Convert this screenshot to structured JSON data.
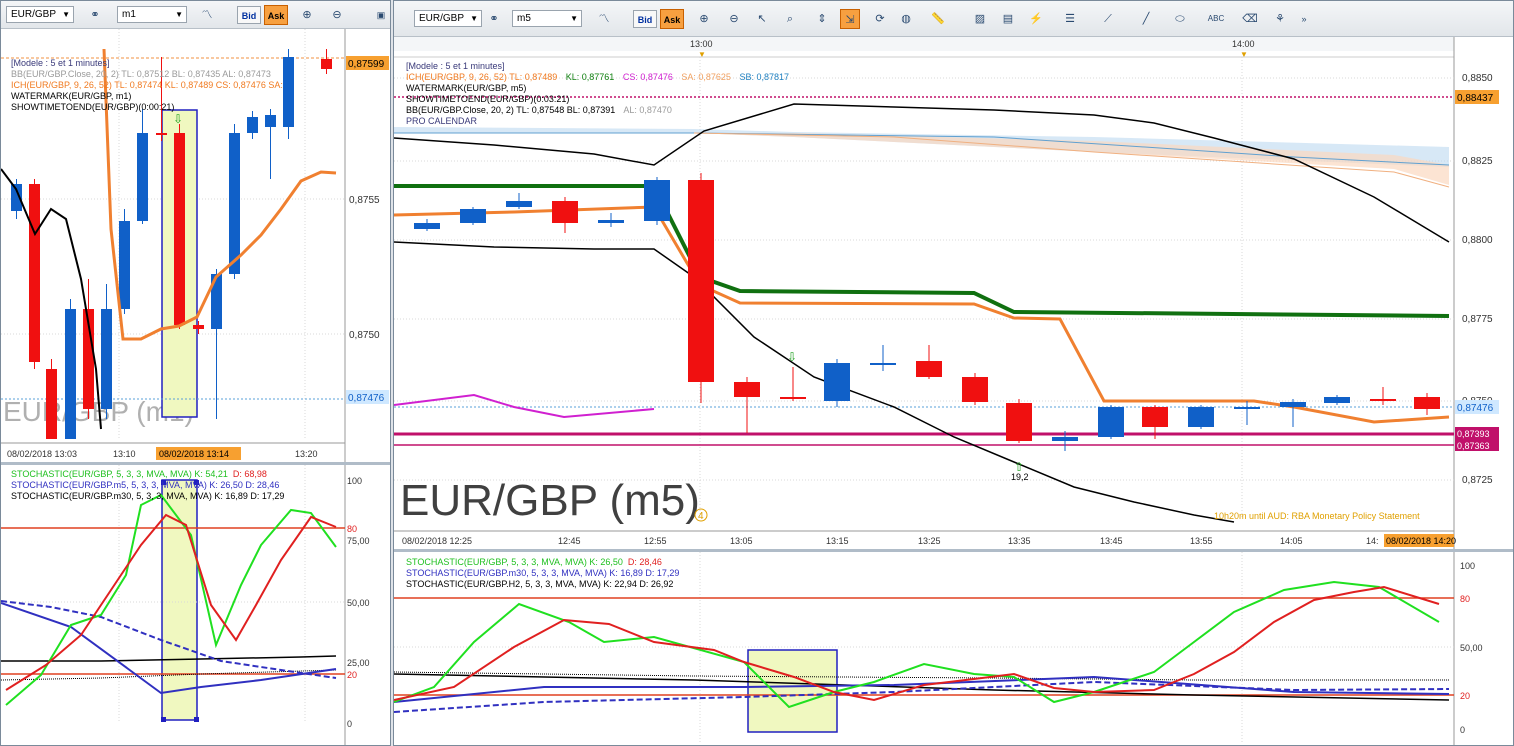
{
  "left": {
    "symbol": "EUR/GBP",
    "timeframe": "m1",
    "bid_label": "Bid",
    "ask_label": "Ask",
    "indicators": [
      {
        "text": "[Modele : 5 et 1 minutes]",
        "color": "#3a3a7a"
      },
      {
        "text": "BB(EUR/GBP.Close, 20, 2)  TL: 0,87512  BL: 0,87435  AL: 0,87473",
        "color": "#9a9a9a"
      },
      {
        "text": "ICH(EUR/GBP, 9, 26, 52)  TL: 0,87474  KL: 0,87489  CS: 0,87476  SA:",
        "color": "#f07a20"
      },
      {
        "text": "WATERMARK(EUR/GBP, m1)",
        "color": "#000000"
      },
      {
        "text": "SHOWTIMETOEND(EUR/GBP)(0:00:21)",
        "color": "#000000"
      }
    ],
    "price_ticks": [
      "0,8755",
      "0,8750"
    ],
    "price_tags": {
      "top": "0,87599",
      "current": "0,87476"
    },
    "time_labels": [
      "08/02/2018 13:03",
      "13:10",
      "13:20"
    ],
    "time_cursor": "08/02/2018 13:14",
    "watermark": "EUR/GBP (m1)",
    "stoch_legend": [
      {
        "text": "STOCHASTIC(EUR/GBP, 5, 3, 3, MVA, MVA)  K: 54,21",
        "extra": "D: 68,98",
        "color": "#20c020",
        "extra_color": "#e02020"
      },
      {
        "text": "STOCHASTIC(EUR/GBP.m5, 5, 3, 3, MVA, MVA)  K: 26,50  D: 28,46",
        "extra": "",
        "color": "#3030c0",
        "extra_color": "#3030c0"
      },
      {
        "text": "STOCHASTIC(EUR/GBP.m30, 5, 3, 3, MVA, MVA)  K: 16,89  D: 17,29",
        "extra": "",
        "color": "#000000",
        "extra_color": "#000000"
      }
    ],
    "stoch_ticks": [
      "100",
      "80",
      "75,00",
      "50,00",
      "25,00",
      "20",
      "0"
    ]
  },
  "right": {
    "symbol": "EUR/GBP",
    "timeframe": "m5",
    "bid_label": "Bid",
    "ask_label": "Ask",
    "indicators": [
      {
        "text": "[Modele : 5 et 1 minutes]",
        "color": "#3a3a7a"
      },
      {
        "text": "ICH(EUR/GBP, 9, 26, 52)  TL: 0,87489",
        "color": "#f07a20"
      },
      {
        "text": "KL: 0,87761",
        "color": "#108010"
      },
      {
        "text": "CS: 0,87476",
        "color": "#d020d0"
      },
      {
        "text": "SA: 0,87625",
        "color": "#f0a060"
      },
      {
        "text": "SB: 0,87817",
        "color": "#2080c0"
      },
      {
        "text": "WATERMARK(EUR/GBP, m5)",
        "color": "#000000"
      },
      {
        "text": "SHOWTIMETOEND(EUR/GBP)(0:03:21)",
        "color": "#000000"
      },
      {
        "text": "BB(EUR/GBP.Close, 20, 2)  TL: 0,87548  BL: 0,87391",
        "color": "#000000"
      },
      {
        "text": "AL: 0,87470",
        "color": "#9a9a9a"
      },
      {
        "text": "PRO CALENDAR",
        "color": "#3a3a7a"
      }
    ],
    "top_times": [
      "13:00",
      "14:00"
    ],
    "price_ticks": [
      "0,8850",
      "0,8825",
      "0,8800",
      "0,8775",
      "0,8750",
      "0,8725"
    ],
    "price_tags": {
      "level": "0,88437",
      "current": "0,87476",
      "level2": "0,87393",
      "level3": "0,87363"
    },
    "time_labels": [
      "08/02/2018 12:25",
      "12:45",
      "12:55",
      "13:05",
      "13:15",
      "13:25",
      "13:35",
      "13:45",
      "13:55",
      "14:05",
      "14:"
    ],
    "time_cursor": "08/02/2018 14:20",
    "watermark": "EUR/GBP (m5)",
    "calendar_note": "10h20m until AUD: RBA Monetary Policy Statement",
    "calendar_marker": "4",
    "fractal_label": "19,2",
    "stoch_legend": [
      {
        "text": "STOCHASTIC(EUR/GBP, 5, 3, 3, MVA, MVA)  K: 26,50",
        "extra": "D: 28,46",
        "color": "#20c020",
        "extra_color": "#e02020"
      },
      {
        "text": "STOCHASTIC(EUR/GBP.m30, 5, 3, 3, MVA, MVA)  K: 16,89  D: 17,29",
        "extra": "",
        "color": "#3030c0",
        "extra_color": "#3030c0"
      },
      {
        "text": "STOCHASTIC(EUR/GBP.H2, 5, 3, 3, MVA, MVA)  K: 22,94  D: 26,92",
        "extra": "",
        "color": "#000000",
        "extra_color": "#000000"
      }
    ],
    "stoch_ticks": [
      "100",
      "80",
      "50,00",
      "20",
      "0"
    ]
  },
  "colors": {
    "bull": "#1060c8",
    "bear": "#f01010",
    "tenkan": "#f08030",
    "kijun": "#107010",
    "chikou": "#d020d0",
    "highlight": "#f0f8c0",
    "tag_orange": "#f7a030",
    "tag_blue": "#cfe8ff",
    "tag_magenta": "#c0106a"
  }
}
